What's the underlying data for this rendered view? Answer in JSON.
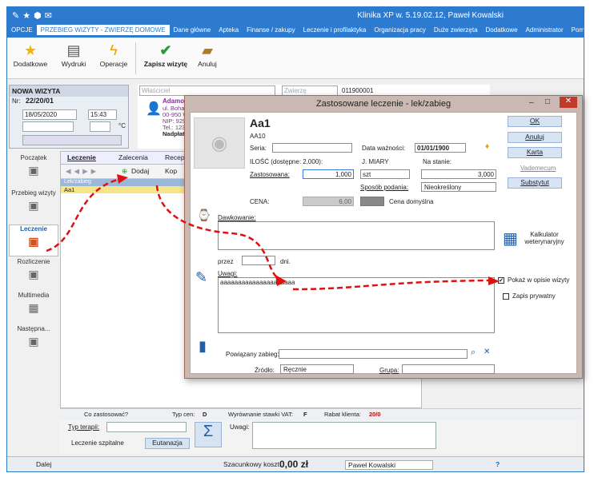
{
  "app": {
    "title": "Klinika XP w. 5.19.02.12, Paweł Kowalski",
    "menu": [
      "OPCJE",
      "PRZEBIEG WIZYTY - ZWIERZĘ DOMOWE",
      "Dane główne",
      "Apteka",
      "Finanse / zakupy",
      "Leczenie i profilaktyka",
      "Organizacja pracy",
      "Duże zwierzęta",
      "Dodatkowe",
      "Administrator",
      "Pomoc"
    ]
  },
  "ribbon": {
    "add": "Dodatkowe",
    "print": "Wydruki",
    "ops": "Operacje",
    "save": "Zapisz wizytę",
    "cancel": "Anuluj"
  },
  "visit": {
    "title": "NOWA WIZYTA",
    "nr_label": "Nr:",
    "nr": "22/20/01",
    "date": "18/05/2020",
    "time": "15:43",
    "owner_ph": "Właściciel",
    "animal_ph": "Zwierzę",
    "animal_code": "011900001",
    "owner_name": "Adamowski",
    "owner_addr1": "ul. Bohaterów",
    "owner_addr2": "00-950 Wa",
    "owner_nip": "NIP: 92911",
    "owner_tel": "Tel.: 12345",
    "owner_overpay": "Nadpłata:",
    "temp_unit": "°C"
  },
  "leftnav": [
    "Początek",
    "Przebieg wizyty",
    "Leczenie",
    "Rozliczenie",
    "Multimedia",
    "Następna..."
  ],
  "panel": {
    "tab1": "Leczenie",
    "tab2": "Zalecenia",
    "tab3": "Recept",
    "add": "Dodaj",
    "kop": "Kop",
    "grid_header": "Lek/zabieg",
    "row1": "Aa1"
  },
  "bottom": {
    "what": "Co zastosować?",
    "price_type_label": "Typ cen:",
    "price_type": "D",
    "vat_label": "Wyrównanie stawki VAT:",
    "vat": "F",
    "discount_label": "Rabat klienta:",
    "discount": "20/0",
    "therapy_label": "Typ terapii:",
    "hospital": "Leczenie szpitalne",
    "euth": "Eutanazja",
    "remarks_label": "Uwagi:"
  },
  "status": {
    "next": "Dalej",
    "cost_label": "Szacunkowy koszt:",
    "cost": "0,00 zł",
    "user": "Paweł Kowalski"
  },
  "dialog": {
    "title": "Zastosowane leczenie - lek/zabieg",
    "name": "Aa1",
    "code": "AA10",
    "seria_label": "Seria:",
    "expiry_label": "Data ważności:",
    "expiry": "01/01/1900",
    "qty_label": "ILOŚĆ (dostępne: 2,000):",
    "unit_label": "J. MIARY",
    "stock_label": "Na stanie:",
    "applied_label": "Zastosowana:",
    "applied": "1,000",
    "unit": "szt",
    "stock": "3,000",
    "method_label": "Sposób podania:",
    "method": "Nieokreślony",
    "price_label": "CENA:",
    "price": "6,00",
    "default_price": "Cena domyślna",
    "dosage_label": "Dawkowanie:",
    "through_label": "przez",
    "days_label": "dni.",
    "calc": "Kalkulator weterynaryjny",
    "remarks_label": "Uwagi:",
    "remarks": "aaaaaaaaaaaaaaaaaaaaa",
    "show_in_desc": "Pokaż w opisie wizyty",
    "private": "Zapis prywatny",
    "related_label": "Powiązany zabieg:",
    "source_label": "Źródło:",
    "source": "Ręcznie",
    "group_label": "Grupa:",
    "btn_ok": "OK",
    "btn_cancel": "Anuluj",
    "btn_card": "Karta",
    "btn_vade": "Vademecum",
    "btn_subst": "Substytut"
  }
}
